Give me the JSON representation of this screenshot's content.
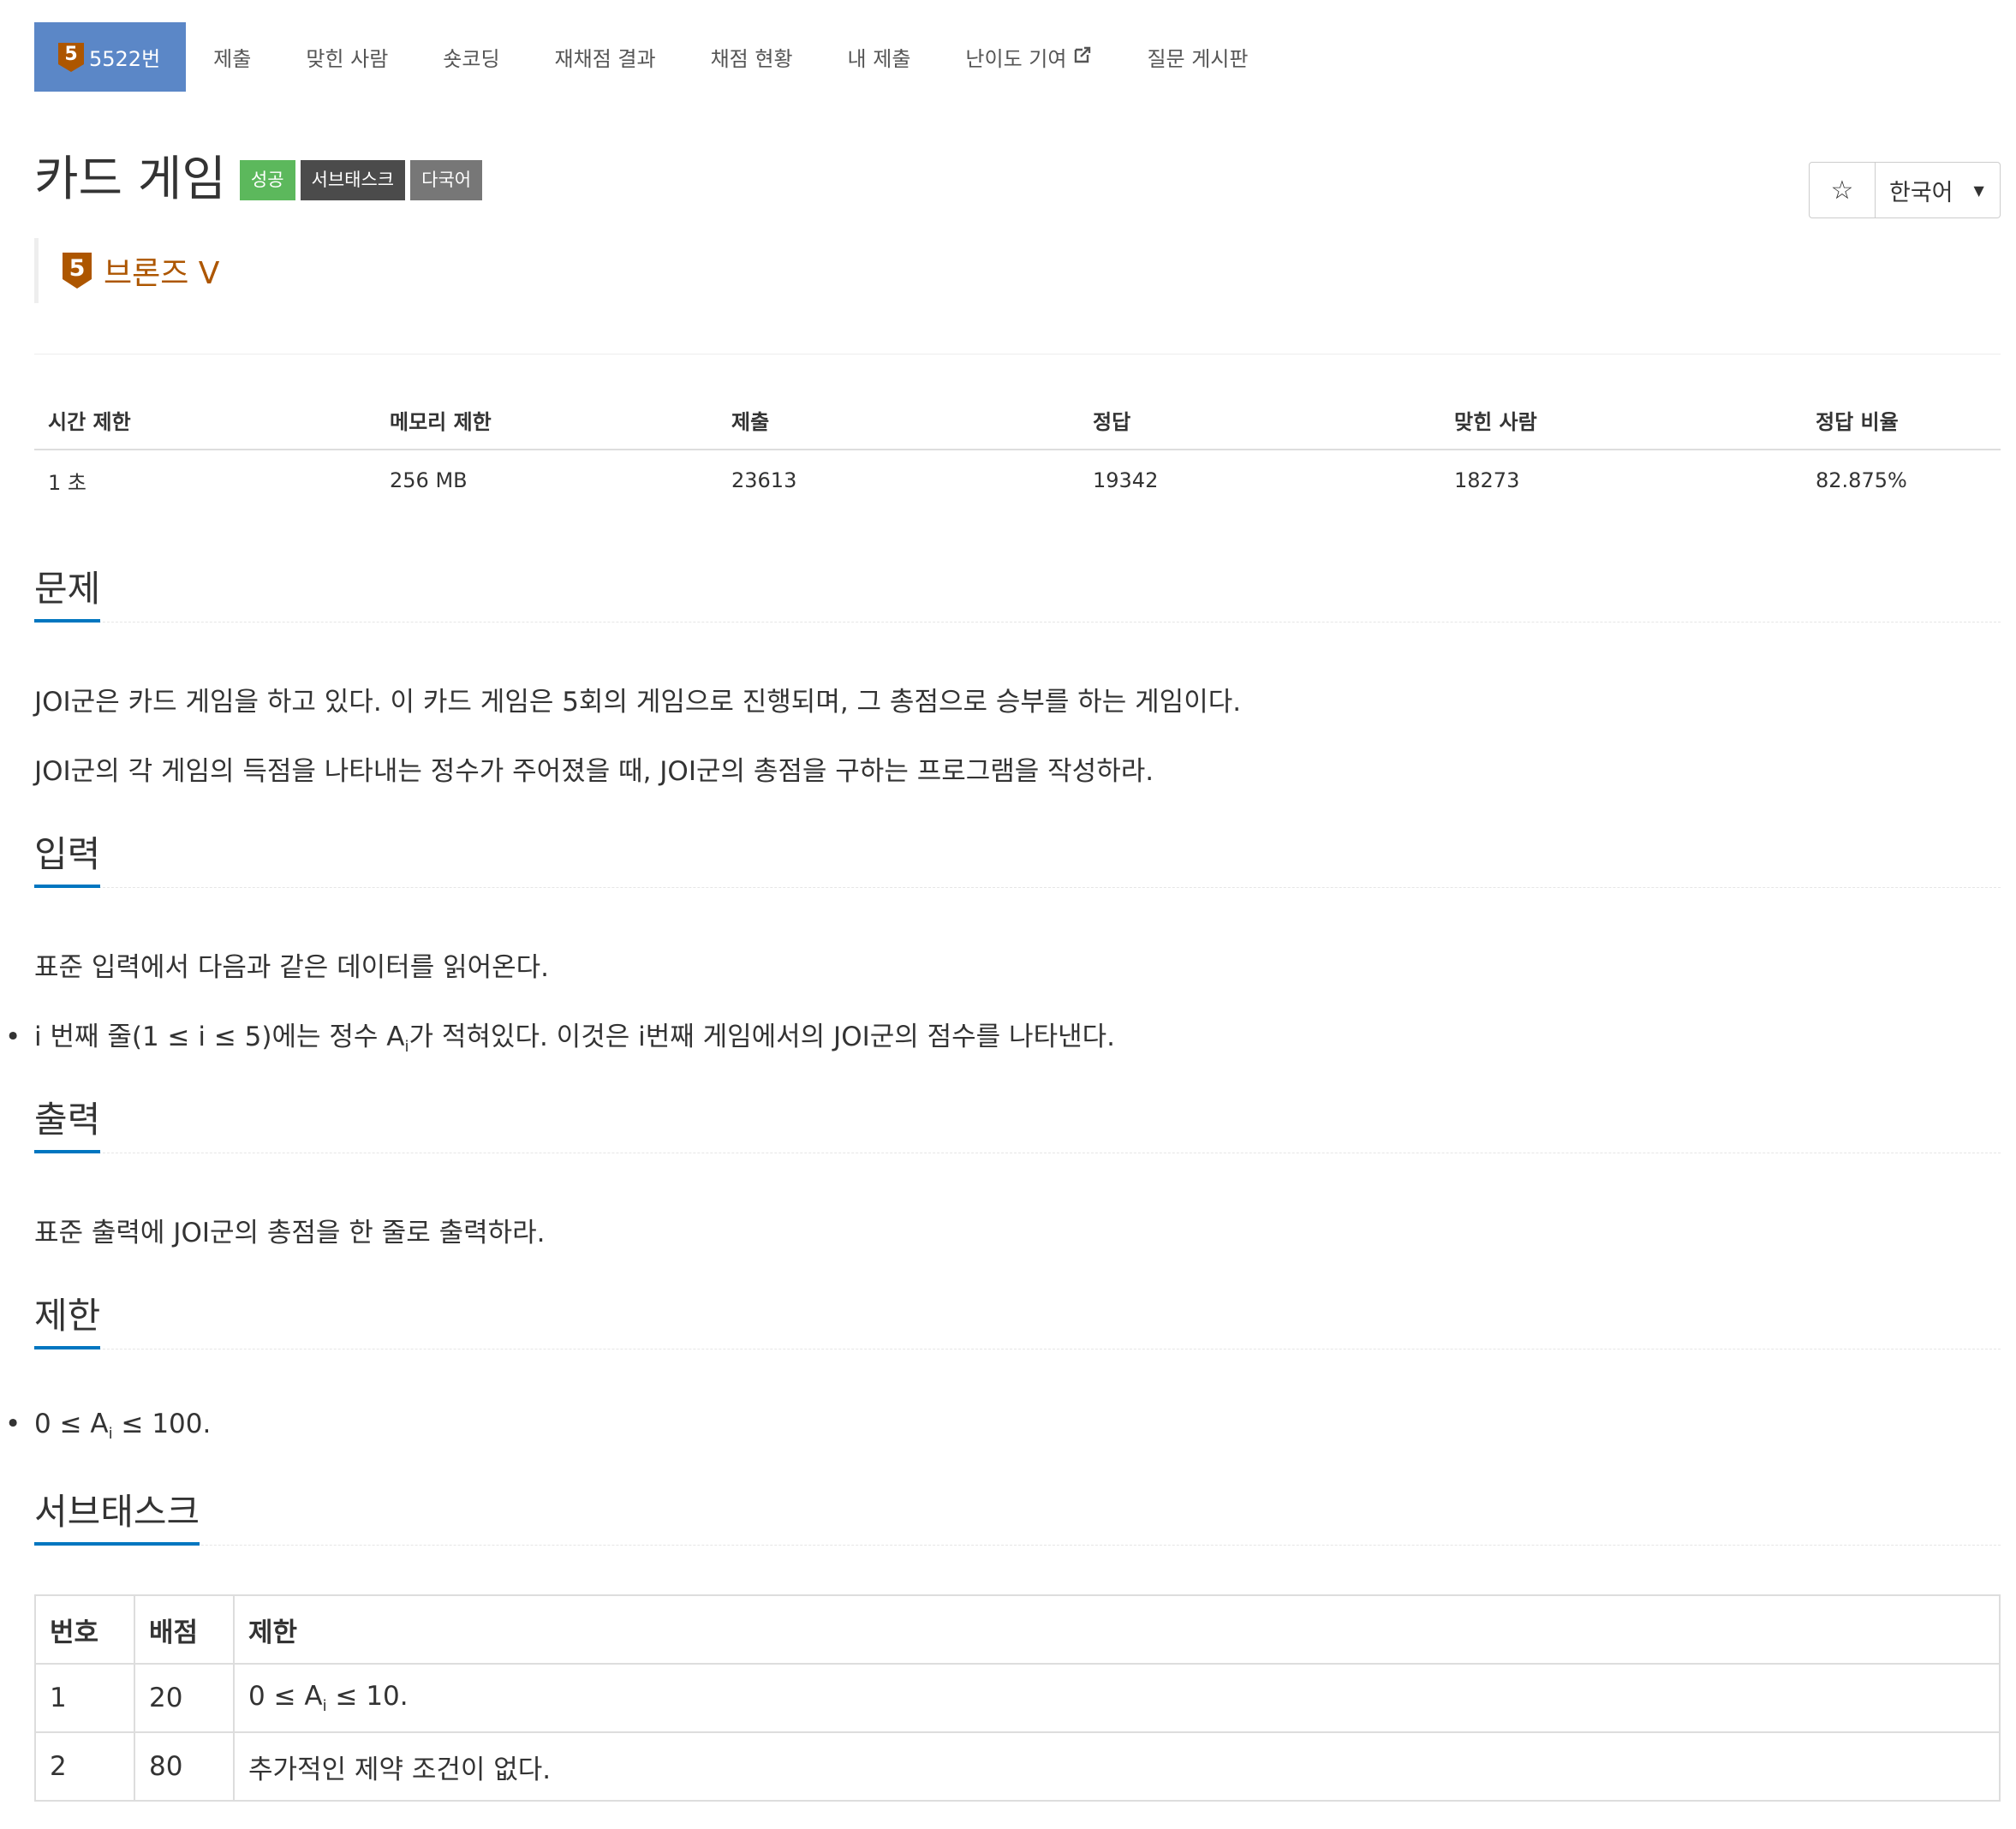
{
  "nav": {
    "problem_number": "5522번",
    "tier_digit": "5",
    "items": [
      "제출",
      "맞힌 사람",
      "숏코딩",
      "재채점 결과",
      "채점 현황",
      "내 제출",
      "난이도 기여",
      "질문 게시판"
    ]
  },
  "colors": {
    "nav_active": "#5b87c7",
    "tier_bronze": "#ad5600",
    "label_success": "#5cb85c",
    "heading_underline": "#0076c0"
  },
  "problem": {
    "title": "카드 게임",
    "labels": [
      "성공",
      "서브태스크",
      "다국어"
    ],
    "tier": "브론즈 V",
    "language": "한국어"
  },
  "info": {
    "headers": [
      "시간 제한",
      "메모리 제한",
      "제출",
      "정답",
      "맞힌 사람",
      "정답 비율"
    ],
    "values": [
      "1 초",
      "256 MB",
      "23613",
      "19342",
      "18273",
      "82.875%"
    ]
  },
  "sections": {
    "description": {
      "title": "문제",
      "p1": "JOI군은 카드 게임을 하고 있다. 이 카드 게임은 5회의 게임으로 진행되며, 그 총점으로 승부를 하는 게임이다.",
      "p2": "JOI군의 각 게임의 득점을 나타내는 정수가 주어졌을 때, JOI군의 총점을 구하는 프로그램을 작성하라."
    },
    "input": {
      "title": "입력",
      "p1": "표준 입력에서 다음과 같은 데이터를 읽어온다.",
      "li_a": "i 번째 줄(1 ≤ i ≤ 5)에는 정수 A",
      "li_sub": "i",
      "li_b": "가 적혀있다. 이것은 i번째 게임에서의 JOI군의 점수를 나타낸다."
    },
    "output": {
      "title": "출력",
      "p1": "표준 출력에 JOI군의 총점을 한 줄로 출력하라."
    },
    "limit": {
      "title": "제한",
      "li_a": "0 ≤ A",
      "li_sub": "i",
      "li_b": " ≤ 100."
    },
    "subtask": {
      "title": "서브태스크",
      "headers": [
        "번호",
        "배점",
        "제한"
      ],
      "rows": [
        {
          "num": "1",
          "score": "20",
          "limit_a": "0 ≤ A",
          "limit_sub": "i",
          "limit_b": " ≤ 10."
        },
        {
          "num": "2",
          "score": "80",
          "limit": "추가적인 제약 조건이 없다."
        }
      ]
    }
  }
}
